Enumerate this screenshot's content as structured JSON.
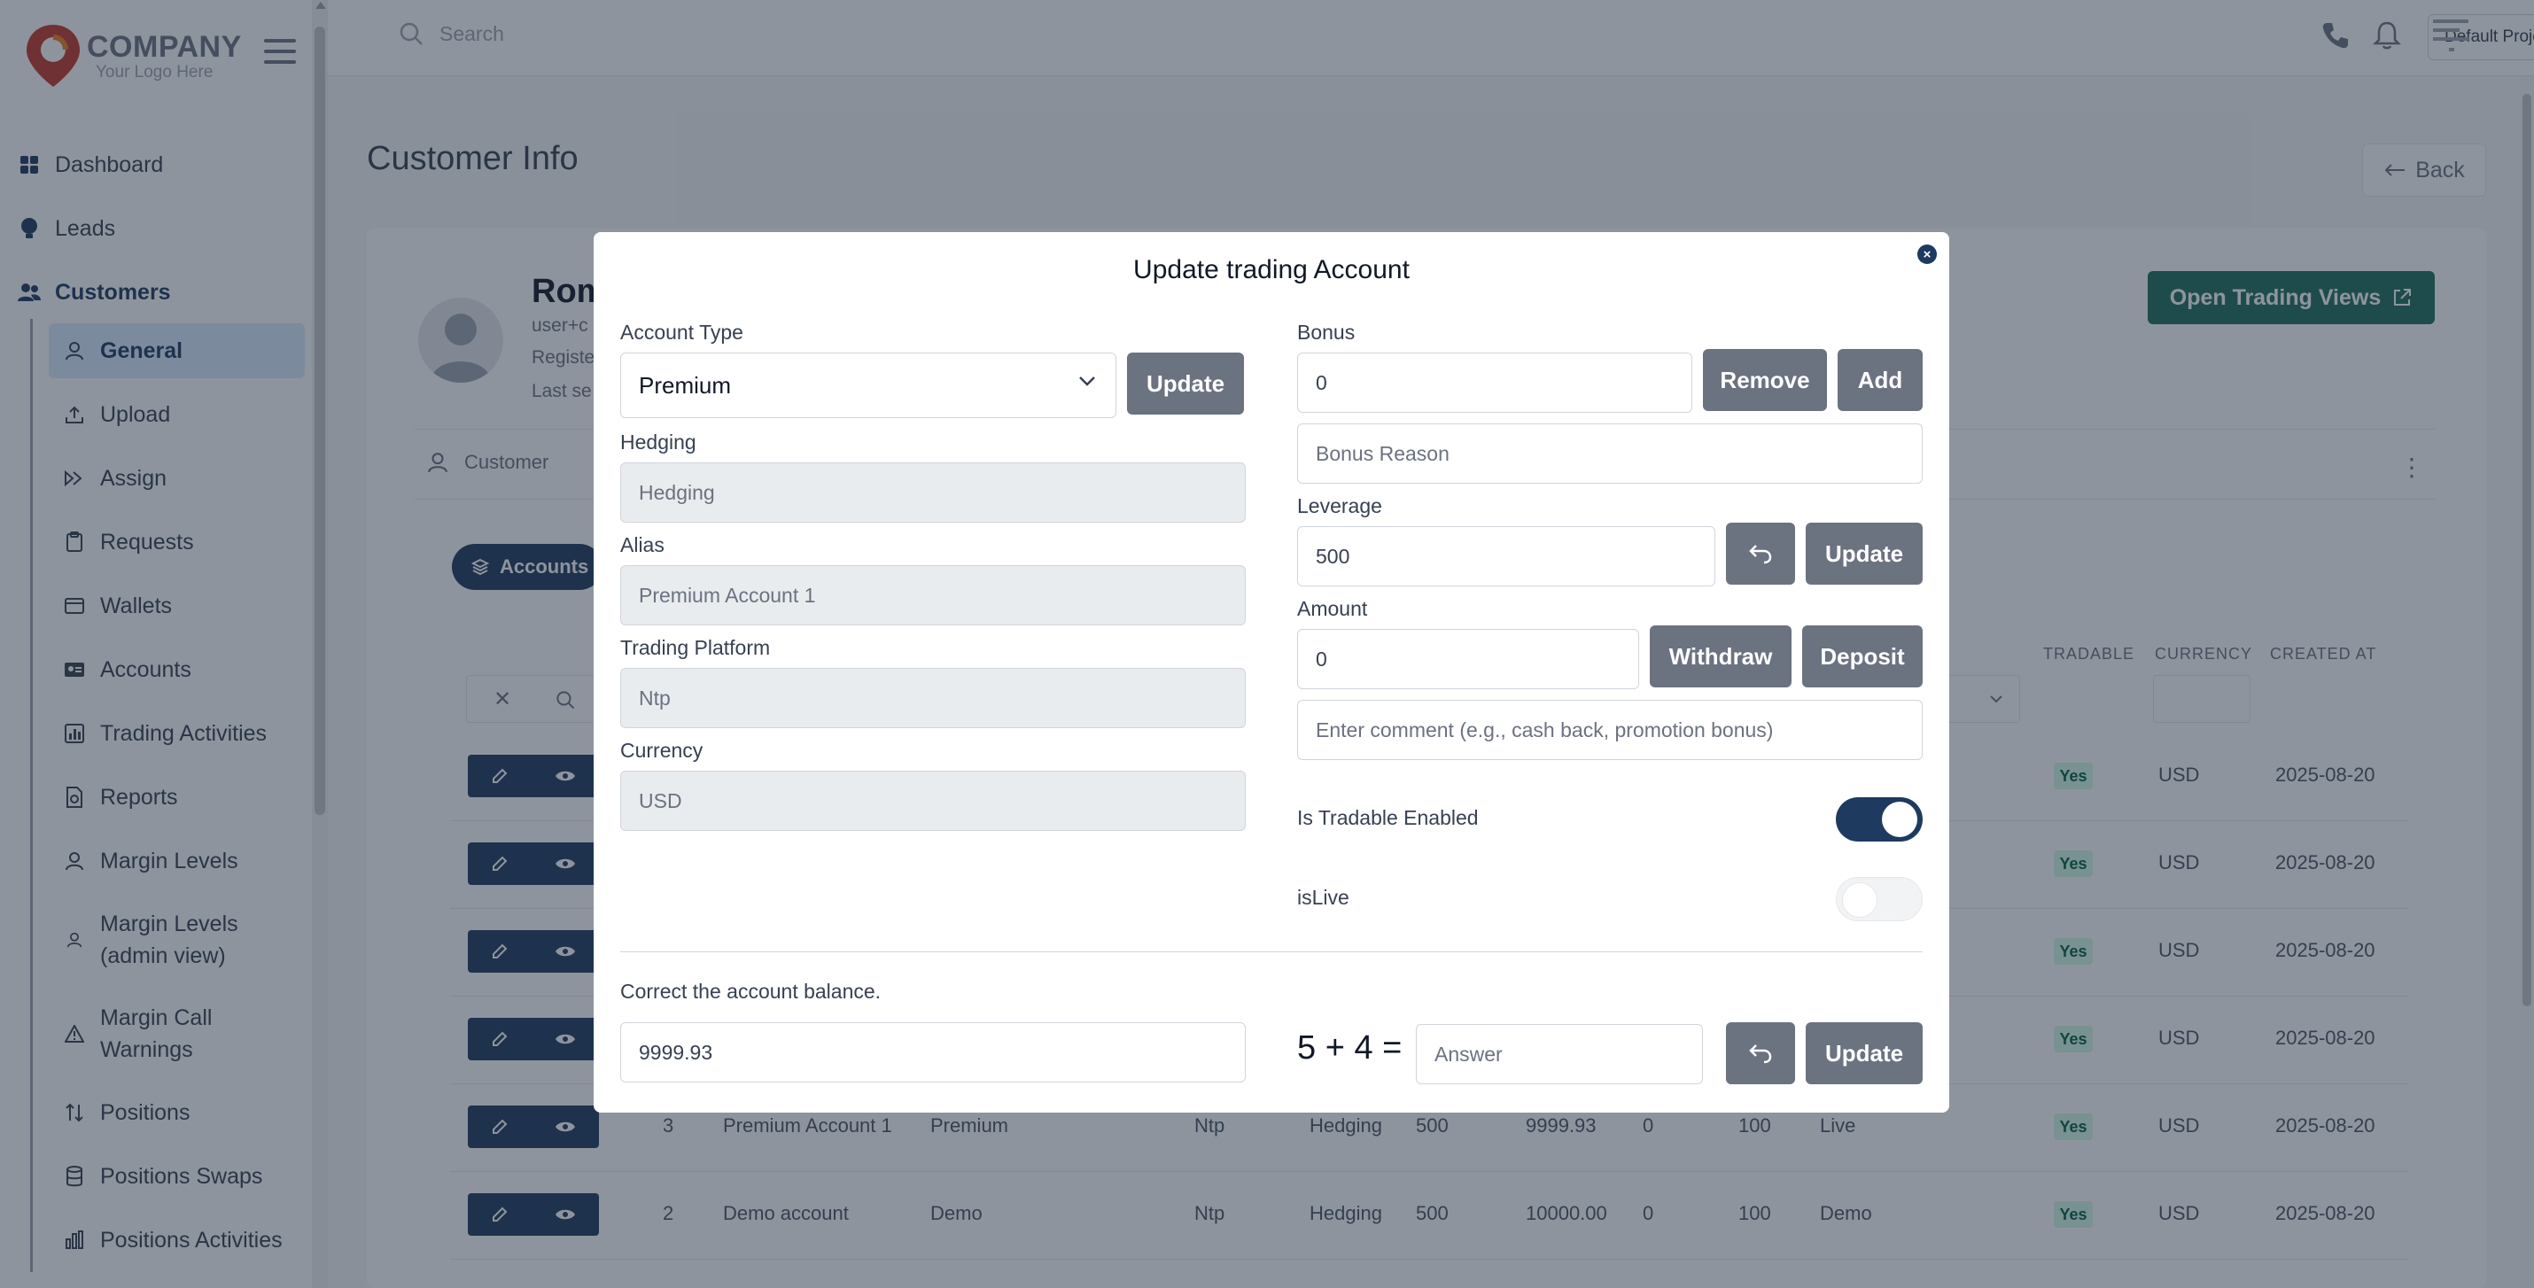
{
  "brand": {
    "company": "COMPANY",
    "tagline": "Your Logo Here"
  },
  "nav_top": [
    {
      "label": "Dashboard",
      "icon": "dashboard-icon"
    },
    {
      "label": "Leads",
      "icon": "bulb-icon"
    },
    {
      "label": "Customers",
      "icon": "users-icon"
    }
  ],
  "subnav": [
    {
      "label": "General"
    },
    {
      "label": "Upload"
    },
    {
      "label": "Assign"
    },
    {
      "label": "Requests"
    },
    {
      "label": "Wallets"
    },
    {
      "label": "Accounts"
    },
    {
      "label": "Trading Activities"
    },
    {
      "label": "Reports"
    },
    {
      "label": "Margin Levels"
    },
    {
      "label": "Margin Levels (admin view)"
    },
    {
      "label": "Margin Call Warnings"
    },
    {
      "label": "Positions"
    },
    {
      "label": "Positions Swaps"
    },
    {
      "label": "Positions Activities"
    }
  ],
  "topbar": {
    "search_placeholder": "Search",
    "project": "Default Project"
  },
  "page": {
    "title": "Customer Info",
    "back_label": "Back",
    "customer_name": "Rom",
    "customer_email": "user+c",
    "registered": "Registe",
    "last_seen": "Last se",
    "open_trading_views": "Open Trading Views",
    "tab_customer": "Customer",
    "pill_accounts": "Accounts"
  },
  "table": {
    "headers": {
      "tradable": "TRADABLE",
      "currency": "CURRENCY",
      "created_at": "CREATED AT"
    },
    "rows": [
      {
        "id": "",
        "alias": "",
        "type": "",
        "platform": "",
        "hedging": "",
        "leverage": "",
        "balance": "",
        "bonus": "",
        "margin": "",
        "live": "",
        "tradable": "Yes",
        "currency": "USD",
        "created": "2025-08-20"
      },
      {
        "id": "",
        "alias": "",
        "type": "",
        "platform": "",
        "hedging": "",
        "leverage": "",
        "balance": "",
        "bonus": "",
        "margin": "",
        "live": "",
        "tradable": "Yes",
        "currency": "USD",
        "created": "2025-08-20"
      },
      {
        "id": "",
        "alias": "",
        "type": "",
        "platform": "",
        "hedging": "",
        "leverage": "",
        "balance": "",
        "bonus": "",
        "margin": "",
        "live": "",
        "tradable": "Yes",
        "currency": "USD",
        "created": "2025-08-20"
      },
      {
        "id": "",
        "alias": "",
        "type": "",
        "platform": "",
        "hedging": "",
        "leverage": "",
        "balance": "",
        "bonus": "",
        "margin": "",
        "live": "",
        "tradable": "Yes",
        "currency": "USD",
        "created": "2025-08-20"
      },
      {
        "id": "3",
        "alias": "Premium Account 1",
        "type": "Premium",
        "platform": "Ntp",
        "hedging": "Hedging",
        "leverage": "500",
        "balance": "9999.93",
        "bonus": "0",
        "margin": "100",
        "live": "Live",
        "tradable": "Yes",
        "currency": "USD",
        "created": "2025-08-20"
      },
      {
        "id": "2",
        "alias": "Demo account",
        "type": "Demo",
        "platform": "Ntp",
        "hedging": "Hedging",
        "leverage": "500",
        "balance": "10000.00",
        "bonus": "0",
        "margin": "100",
        "live": "Demo",
        "tradable": "Yes",
        "currency": "USD",
        "created": "2025-08-20"
      }
    ]
  },
  "modal": {
    "title": "Update trading Account",
    "account_type_label": "Account Type",
    "account_type_value": "Premium",
    "update_label": "Update",
    "hedging_label": "Hedging",
    "hedging_placeholder": "Hedging",
    "alias_label": "Alias",
    "alias_placeholder": "Premium Account 1",
    "platform_label": "Trading Platform",
    "platform_placeholder": "Ntp",
    "currency_label": "Currency",
    "currency_placeholder": "USD",
    "bonus_label": "Bonus",
    "bonus_value": "0",
    "remove_label": "Remove",
    "add_label": "Add",
    "bonus_reason_placeholder": "Bonus Reason",
    "leverage_label": "Leverage",
    "leverage_value": "500",
    "amount_label": "Amount",
    "amount_value": "0",
    "withdraw_label": "Withdraw",
    "deposit_label": "Deposit",
    "comment_placeholder": "Enter comment (e.g., cash back, promotion bonus)",
    "tradable_label": "Is Tradable Enabled",
    "tradable_on": true,
    "islive_label": "isLive",
    "islive_on": false,
    "correct_balance_label": "Correct the account balance.",
    "balance_value": "9999.93",
    "captcha": "5 + 4 =",
    "answer_placeholder": "Answer"
  },
  "colors": {
    "navy": "#1e3a5f",
    "button_gray": "#6b7280",
    "overlay": "#1e293b"
  }
}
